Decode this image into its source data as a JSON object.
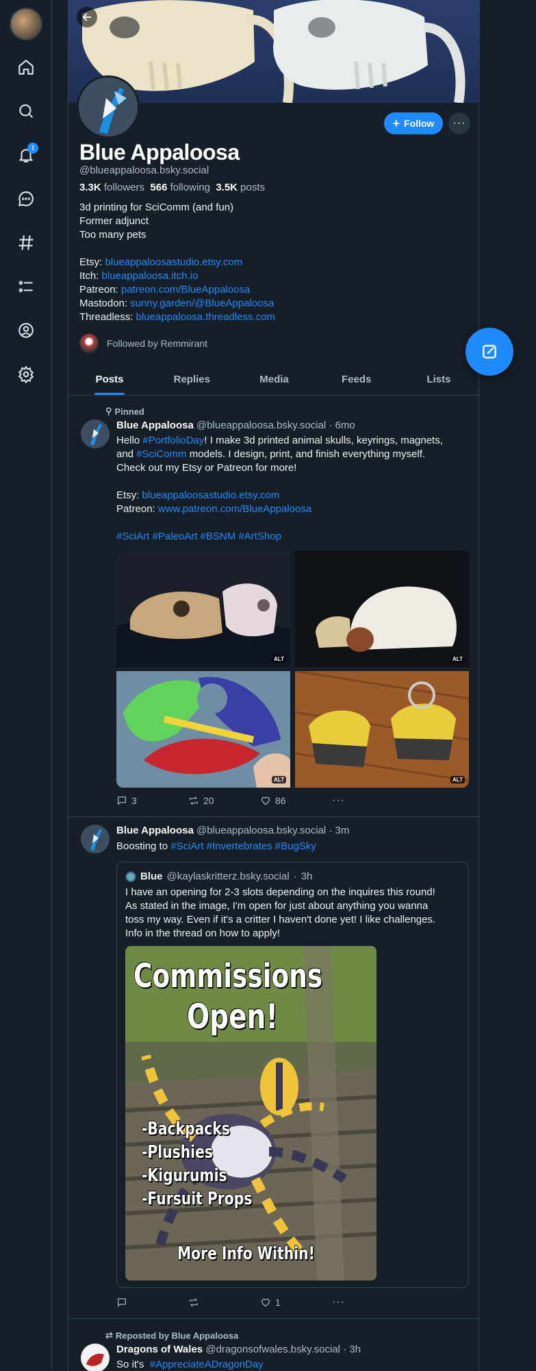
{
  "profile": {
    "display_name": "Blue Appaloosa",
    "handle": "@blueappaloosa.bsky.social",
    "followers_count": "3.3K",
    "followers_label": "followers",
    "following_count": "566",
    "following_label": "following",
    "posts_count": "3.5K",
    "posts_label": "posts",
    "follow_label": "Follow",
    "bio": {
      "line1": "3d printing for SciComm (and fun)",
      "line2": "Former adjunct",
      "line3": "Too many pets",
      "etsy_label": "Etsy:",
      "etsy_link": "blueappaloosastudio.etsy.com",
      "itch_label": "Itch:",
      "itch_link": "blueappaloosa.itch.io",
      "patreon_label": "Patreon:",
      "patreon_link": "patreon.com/BlueAppaloosa",
      "mastodon_label": "Mastodon:",
      "mastodon_link": "sunny.garden/@BlueAppaloosa",
      "threadless_label": "Threadless:",
      "threadless_link": "blueappaloosa.threadless.com"
    },
    "followed_by": "Followed by Remmirant"
  },
  "nav": {
    "notification_count": "1"
  },
  "tabs": [
    "Posts",
    "Replies",
    "Media",
    "Feeds",
    "Lists"
  ],
  "post1": {
    "pinned_label": "Pinned",
    "author": "Blue Appaloosa",
    "handle": "@blueappaloosa.bsky.social",
    "time": "6mo",
    "text": {
      "l1a": "Hello ",
      "l1tag": "#PortfolioDay",
      "l1b": "! I make 3d printed animal skulls, keyrings, magnets,",
      "l2a": "and ",
      "l2tag": "#SciComm",
      "l2b": " models. I design, print, and finish everything myself.",
      "l3": "Check out my Etsy or Patreon for more!",
      "etsy_label": "Etsy: ",
      "etsy_link": "blueappaloosastudio.etsy.com",
      "patreon_label": "Patreon: ",
      "patreon_link": "www.patreon.com/BlueAppaloosa",
      "tags": "#SciArt #PaleoArt #BSNM #ArtShop"
    },
    "alt_label": "ALT",
    "replies": "3",
    "reposts": "20",
    "likes": "86"
  },
  "post2": {
    "author": "Blue Appaloosa",
    "handle": "@blueappaloosa.bsky.social",
    "time": "3m",
    "text_a": "Boosting to ",
    "tags": "#SciArt #Invertebrates #BugSky",
    "quote": {
      "author": "Blue",
      "handle": "@kaylaskritterz.bsky.social",
      "time": "3h",
      "l1": "I have an opening for 2-3 slots depending on the inquires this round!",
      "l2": "As stated in the image, I'm open for just about anything you wanna",
      "l3": "toss my way. Even if it's a critter I haven't done yet! I like challenges.",
      "l4": "Info in the thread on how to apply!",
      "image_text": {
        "title1": "Commissions",
        "title2": "Open!",
        "item1": "-Backpacks",
        "item2": "-Plushies",
        "item3": "-Kigurumis",
        "item4": "-Fursuit Props",
        "footer": "More Info Within!"
      }
    },
    "replies": "",
    "reposts": "",
    "likes": "1"
  },
  "post3": {
    "repost_label": "Reposted by Blue Appaloosa",
    "author": "Dragons of Wales",
    "handle": "@dragonsofwales.bsky.social",
    "time": "3h",
    "text_a": "So it's  ",
    "tag": "#AppreciateADragonDay"
  },
  "colors": {
    "accent": "#208bfe",
    "background": "#161e27",
    "border": "#2e4052"
  }
}
